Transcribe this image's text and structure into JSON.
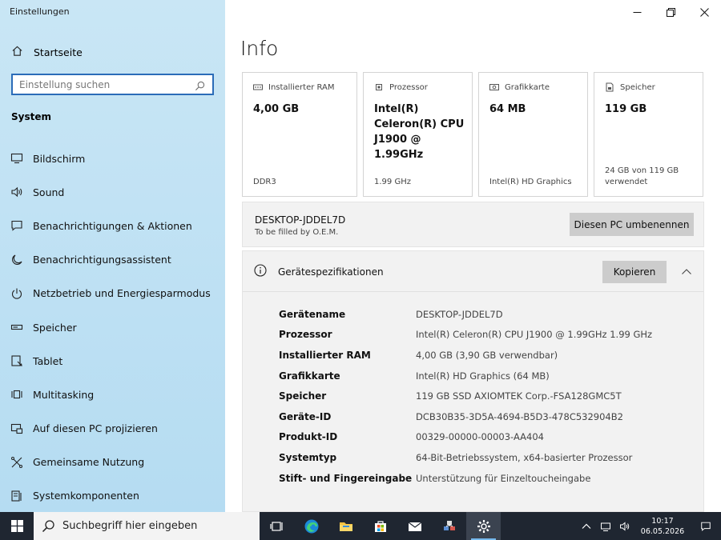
{
  "app_title": "Einstellungen",
  "sidebar": {
    "home_label": "Startseite",
    "search_placeholder": "Einstellung suchen",
    "section": "System",
    "items": [
      {
        "label": "Bildschirm",
        "icon": "monitor-icon"
      },
      {
        "label": "Sound",
        "icon": "speaker-icon"
      },
      {
        "label": "Benachrichtigungen & Aktionen",
        "icon": "notification-icon"
      },
      {
        "label": "Benachrichtigungsassistent",
        "icon": "moon-icon"
      },
      {
        "label": "Netzbetrieb und Energiesparmodus",
        "icon": "power-icon"
      },
      {
        "label": "Speicher",
        "icon": "storage-icon"
      },
      {
        "label": "Tablet",
        "icon": "tablet-icon"
      },
      {
        "label": "Multitasking",
        "icon": "multitasking-icon"
      },
      {
        "label": "Auf diesen PC projizieren",
        "icon": "project-icon"
      },
      {
        "label": "Gemeinsame Nutzung",
        "icon": "share-icon"
      },
      {
        "label": "Systemkomponenten",
        "icon": "components-icon"
      }
    ]
  },
  "main": {
    "title": "Info",
    "cards": [
      {
        "head": "Installierter RAM",
        "value": "4,00 GB",
        "sub": "DDR3"
      },
      {
        "head": "Prozessor",
        "value": "Intel(R) Celeron(R) CPU  J1900  @ 1.99GHz",
        "sub": "1.99 GHz"
      },
      {
        "head": "Grafikkarte",
        "value": "64 MB",
        "sub": "Intel(R) HD Graphics"
      },
      {
        "head": "Speicher",
        "value": "119 GB",
        "sub": "24 GB von 119 GB verwendet"
      }
    ],
    "pc_name": "DESKTOP-JDDEL7D",
    "pc_sub": "To be filled by O.E.M.",
    "rename_button": "Diesen PC umbenennen",
    "spec_title": "Gerätespezifikationen",
    "copy_button": "Kopieren",
    "specs": [
      {
        "k": "Gerätename",
        "v": "DESKTOP-JDDEL7D"
      },
      {
        "k": "Prozessor",
        "v": "Intel(R) Celeron(R) CPU  J1900  @ 1.99GHz   1.99 GHz"
      },
      {
        "k": "Installierter RAM",
        "v": "4,00 GB (3,90 GB verwendbar)"
      },
      {
        "k": "Grafikkarte",
        "v": "Intel(R) HD Graphics (64 MB)"
      },
      {
        "k": "Speicher",
        "v": "119 GB SSD AXIOMTEK Corp.-FSA128GMC5T"
      },
      {
        "k": "Geräte-ID",
        "v": "DCB30B35-3D5A-4694-B5D3-478C532904B2"
      },
      {
        "k": "Produkt-ID",
        "v": "00329-00000-00003-AA404"
      },
      {
        "k": "Systemtyp",
        "v": "64-Bit-Betriebssystem, x64-basierter Prozessor"
      },
      {
        "k": "Stift- und Fingereingabe",
        "v": "Unterstützung für Einzeltoucheingabe"
      }
    ]
  },
  "taskbar": {
    "search_placeholder": "Suchbegriff hier eingeben",
    "time": "10:17",
    "date": "06.05.2026"
  },
  "colors": {
    "sidebar_bg": "#bde0f3",
    "search_border": "#2b6cb8",
    "taskbar_bg": "#1f2631",
    "accent": "#76b9ed"
  }
}
